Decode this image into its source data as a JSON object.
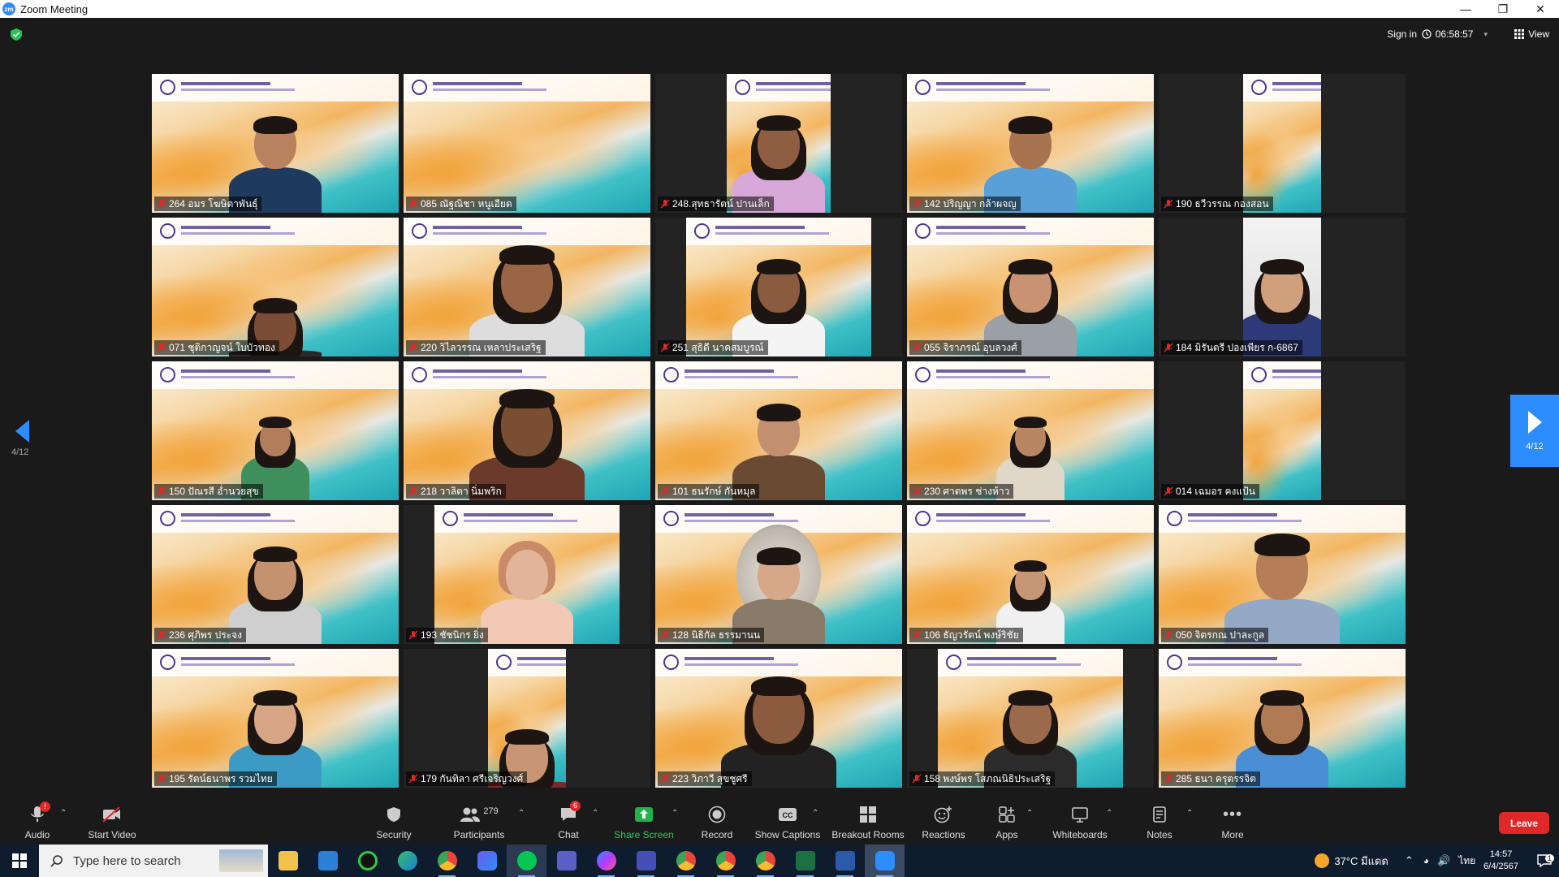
{
  "window": {
    "title": "Zoom Meeting",
    "logo_text": "zm"
  },
  "topbar": {
    "sign_in": "Sign in",
    "timer": "06:58:57",
    "view_label": "View"
  },
  "pagination": {
    "left_indicator": "4/12",
    "right_indicator": "4/12"
  },
  "participants": [
    {
      "name": "264 อมร โฆษิตาพันธุ์"
    },
    {
      "name": "085 ณัฐณิชา หนูเอียด"
    },
    {
      "name": "248.สุทธารัตน์ ปานเล็ก"
    },
    {
      "name": "142 ปริญญา กล้าผจญ"
    },
    {
      "name": "190 ธวีวรรณ กองสอน"
    },
    {
      "name": "071 ชุติกาญจน์ ใบบัวทอง"
    },
    {
      "name": "220 วิไลวรรณ เหลาประเสริฐ"
    },
    {
      "name": "251 สุธิดี นาคสมบูรณ์"
    },
    {
      "name": "055 จิราภรณ์ อุบลวงศ์"
    },
    {
      "name": "184 มิรันตรี ปองเพียร ก-6867"
    },
    {
      "name": "150 ปัณรสี อ่ำนวยสุข"
    },
    {
      "name": "218 วาลิตา นิ่มพริก"
    },
    {
      "name": "101 ธนรักษ์ กันหมุล"
    },
    {
      "name": "230 ศาตพร ช่างห้าว"
    },
    {
      "name": "014 เฉมอร คงแป้น"
    },
    {
      "name": "236 ศุภิพร ประจง"
    },
    {
      "name": "193 ชัชนิกร ยิ่ง"
    },
    {
      "name": "128 นิธิกัล ธรรมานน"
    },
    {
      "name": "106 ธัญวรัตน์ พงษ์ริชัย"
    },
    {
      "name": "050 จิตรกณ ปาละกูล"
    },
    {
      "name": "195 รัตน์ธนาพร รวมไทย"
    },
    {
      "name": "179 กันทิลา ศรีเจริญวงศ์"
    },
    {
      "name": "223 วิภาวี สุขชูศรี"
    },
    {
      "name": "158 พงษ์พร โสภณนิธิประเสริฐ"
    },
    {
      "name": "285 ธนา ครุตรรจิต"
    }
  ],
  "controls": {
    "audio": "Audio",
    "audio_badge": "!",
    "start_video": "Start Video",
    "security": "Security",
    "participants": "Participants",
    "participants_count": "279",
    "chat": "Chat",
    "chat_badge": "6",
    "share_screen": "Share Screen",
    "record": "Record",
    "show_captions": "Show Captions",
    "breakout_rooms": "Breakout Rooms",
    "reactions": "Reactions",
    "apps": "Apps",
    "whiteboards": "Whiteboards",
    "notes": "Notes",
    "more": "More",
    "leave": "Leave"
  },
  "taskbar": {
    "search_placeholder": "Type here to search",
    "weather": "37°C มีแดด",
    "lang": "ไทย",
    "time": "14:57",
    "date": "6/4/2567",
    "notification_count": "1"
  },
  "colors": {
    "zoom_blue": "#2d8cff",
    "leave_red": "#e02828",
    "share_green": "#22b14c"
  }
}
